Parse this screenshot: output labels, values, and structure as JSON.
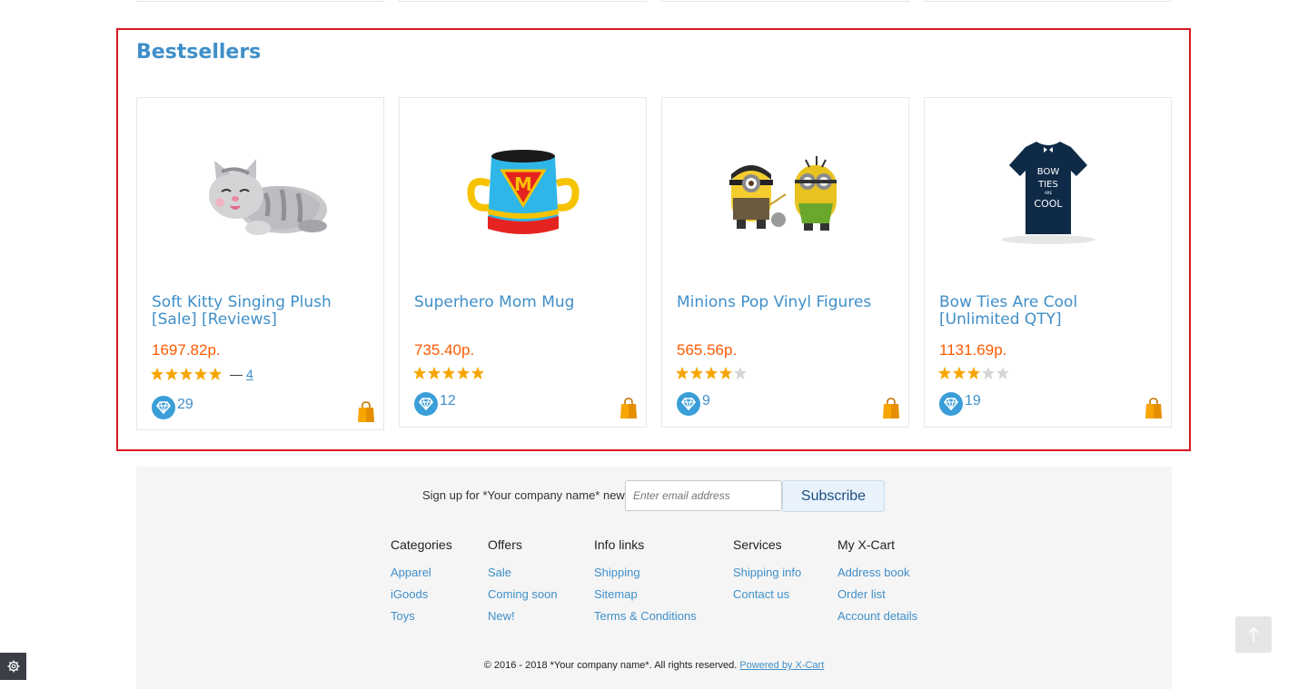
{
  "bestsellers": {
    "title": "Bestsellers",
    "products": [
      {
        "name": "Soft Kitty Singing Plush [Sale] [Reviews]",
        "price": "1697.82р.",
        "rating": 5,
        "reviews_dash": "—",
        "reviews_count": "4",
        "reward_points": "29",
        "image": "plush-kitty-image"
      },
      {
        "name": "Superhero Mom Mug",
        "price": "735.40р.",
        "rating": 5,
        "reward_points": "12",
        "image": "mug-image"
      },
      {
        "name": "Minions Pop Vinyl Figures",
        "price": "565.56р.",
        "rating": 4,
        "reward_points": "9",
        "image": "minions-image"
      },
      {
        "name": "Bow Ties Are Cool [Unlimited QTY]",
        "price": "1131.69р.",
        "rating": 3,
        "reward_points": "19",
        "image": "tshirt-image"
      }
    ],
    "tshirt_text": [
      "BOW",
      "TIES",
      "ARE",
      "COOL"
    ]
  },
  "footer": {
    "signup_label": "Sign up for *Your company name* news",
    "email_placeholder": "Enter email address",
    "subscribe_label": "Subscribe",
    "columns": [
      {
        "title": "Categories",
        "links": [
          "Apparel",
          "iGoods",
          "Toys"
        ]
      },
      {
        "title": "Offers",
        "links": [
          "Sale",
          "Coming soon",
          "New!"
        ]
      },
      {
        "title": "Info links",
        "links": [
          "Shipping",
          "Sitemap",
          "Terms & Conditions"
        ]
      },
      {
        "title": "Services",
        "links": [
          "Shipping info",
          "Contact us"
        ]
      },
      {
        "title": "My X-Cart",
        "links": [
          "Address book",
          "Order list",
          "Account details"
        ]
      }
    ],
    "copyright": "© 2016 - 2018 *Your company name*. All rights reserved.",
    "powered_by": "Powered by X-Cart"
  },
  "colors": {
    "accent": "#3f8fc9",
    "price": "#ff5a00",
    "star": "#f7a500",
    "highlight_border": "#d7191f"
  },
  "icons": {
    "back_to_top": "arrow-up-icon",
    "settings": "gear-icon",
    "bag": "shopping-bag-icon",
    "reward": "diamond-icon"
  }
}
